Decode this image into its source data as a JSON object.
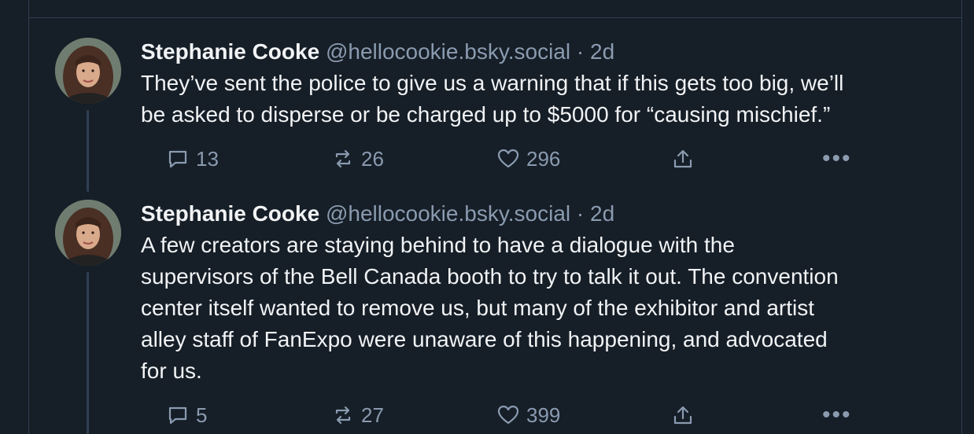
{
  "posts": [
    {
      "author": "Stephanie Cooke",
      "handle": "@hellocookie.bsky.social",
      "separator": "·",
      "time": "2d",
      "text": "They’ve sent the police to give us a warning that if this gets too big, we’ll\nbe asked to disperse or be charged up to $5000 for “causing mischief.”",
      "replies": "13",
      "reposts": "26",
      "likes": "296"
    },
    {
      "author": "Stephanie Cooke",
      "handle": "@hellocookie.bsky.social",
      "separator": "·",
      "time": "2d",
      "text": "A few creators are staying behind to have a dialogue with the\nsupervisors of the Bell Canada booth to try to talk it out. The convention\ncenter itself wanted to remove us, but many of the exhibitor and artist\nalley staff of FanExpo were unaware of this happening, and advocated\nfor us.",
      "replies": "5",
      "reposts": "27",
      "likes": "399"
    }
  ],
  "icons": {
    "reply": "reply-icon",
    "repost": "repost-icon",
    "like": "heart-icon",
    "share": "share-icon",
    "more": "more-icon"
  },
  "colors": {
    "background": "#161e27",
    "border": "#2e4052",
    "muted": "#8a9bb0",
    "text": "#f1f3f5"
  }
}
